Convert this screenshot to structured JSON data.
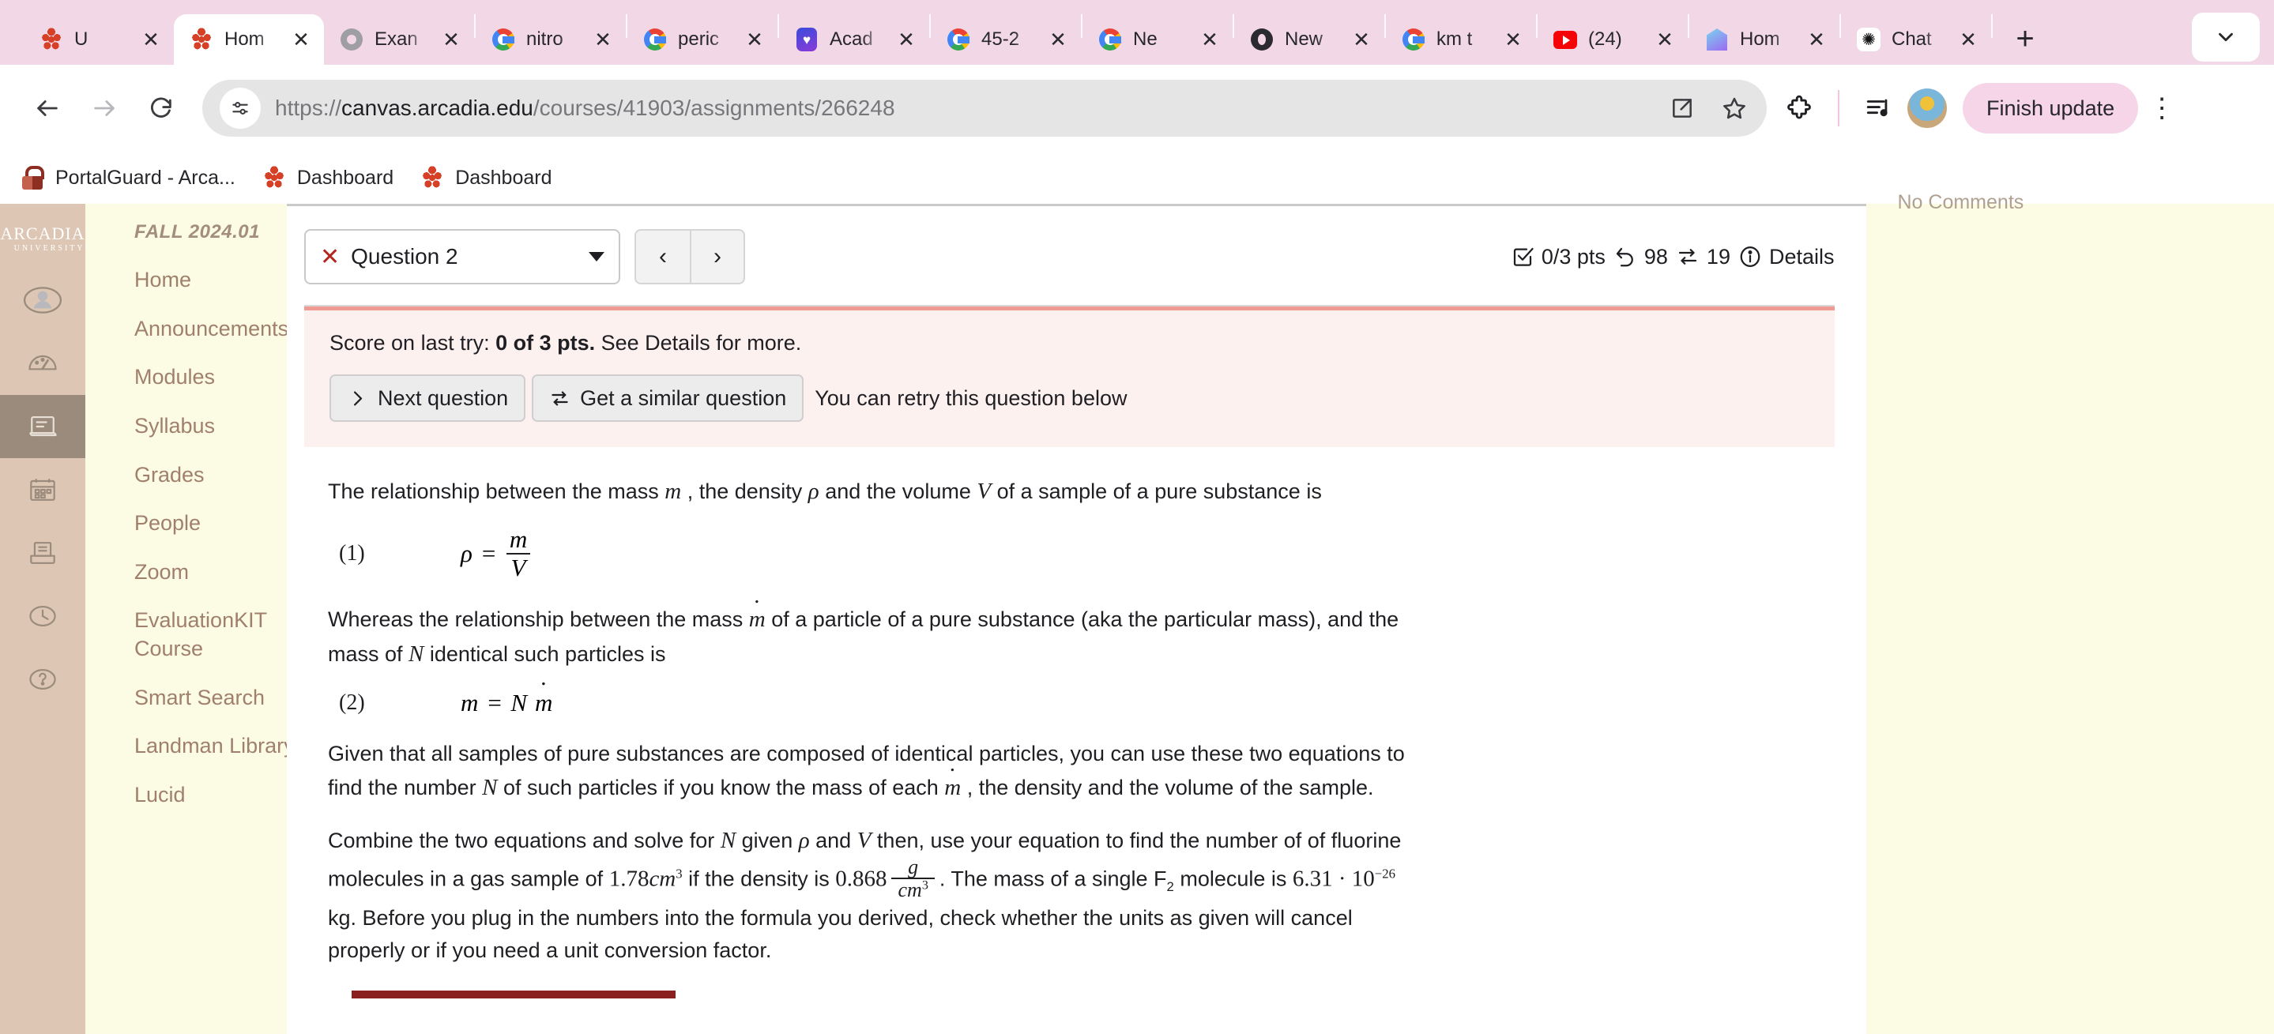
{
  "browser": {
    "tabs": [
      {
        "title": "U",
        "icon": "canvas-icon",
        "active": false,
        "favicon_extra": "😎"
      },
      {
        "title": "Hom",
        "icon": "canvas-icon",
        "active": true
      },
      {
        "title": "Exan",
        "icon": "grey-globe-icon",
        "active": false
      },
      {
        "title": "nitro",
        "icon": "google-icon",
        "active": false
      },
      {
        "title": "peric",
        "icon": "google-icon",
        "active": false
      },
      {
        "title": "Acad",
        "icon": "academia-heart-icon",
        "active": false
      },
      {
        "title": "45-2",
        "icon": "google-icon",
        "active": false
      },
      {
        "title": "Ne",
        "icon": "google-icon",
        "active": false
      },
      {
        "title": "New",
        "icon": "opera-icon",
        "active": false
      },
      {
        "title": "km t",
        "icon": "google-icon",
        "active": false
      },
      {
        "title": "(24)",
        "icon": "youtube-icon",
        "active": false
      },
      {
        "title": "Hom",
        "icon": "home-gem-icon",
        "active": false
      },
      {
        "title": "Chat",
        "icon": "chatgpt-icon",
        "active": false
      }
    ],
    "new_tab_label": "+",
    "url_full": "https://canvas.arcadia.edu/courses/41903/assignments/266248",
    "url_scheme": "https://",
    "url_host": "canvas.arcadia.edu",
    "url_path": "/courses/41903/assignments/266248",
    "finish_update_label": "Finish update",
    "bookmarks": [
      {
        "label": "PortalGuard - Arca...",
        "icon": "portalguard-lock-icon"
      },
      {
        "label": "Dashboard",
        "icon": "canvas-icon"
      },
      {
        "label": "Dashboard",
        "icon": "canvas-icon"
      }
    ]
  },
  "rail": {
    "logo_line1": "ARCADIA",
    "logo_line2": "UNIVERSITY",
    "items": [
      {
        "name": "account",
        "icon": "user-avatar-icon"
      },
      {
        "name": "dashboard",
        "icon": "gauge-icon"
      },
      {
        "name": "courses",
        "icon": "book-icon",
        "active": true
      },
      {
        "name": "calendar",
        "icon": "calendar-icon"
      },
      {
        "name": "inbox",
        "icon": "inbox-icon"
      },
      {
        "name": "history",
        "icon": "clock-icon"
      },
      {
        "name": "help",
        "icon": "question-icon"
      }
    ]
  },
  "course_nav": {
    "term": "FALL 2024.01",
    "items": [
      "Home",
      "Announcements",
      "Modules",
      "Syllabus",
      "Grades",
      "People",
      "Zoom",
      "EvaluationKIT Course",
      "Smart Search",
      "Landman Library",
      "Lucid"
    ]
  },
  "quiz": {
    "question_selector": {
      "label": "Question 2",
      "status_icon": "x-incorrect-icon"
    },
    "nav": {
      "prev": "‹",
      "next": "›"
    },
    "stats": {
      "points": "0/3 pts",
      "attempts": "98",
      "similar": "19",
      "details_label": "Details",
      "icons": [
        "checkbox-icon",
        "undo-arrow-icon",
        "swap-arrows-icon",
        "info-icon"
      ]
    },
    "alert": {
      "score_prefix": "Score on last try: ",
      "score_bold": "0 of 3 pts.",
      "score_suffix": " See Details for more.",
      "next_question_label": "Next question",
      "similar_question_label": "Get a similar question",
      "retry_note": "You can retry this question below"
    },
    "body": {
      "p1_a": "The relationship between the mass ",
      "p1_m": "m",
      "p1_b": " , the density ",
      "p1_rho": "ρ",
      "p1_c": " and the volume ",
      "p1_V": "V",
      "p1_d": " of a sample of a pure substance is",
      "eq1_number": "(1)",
      "eq1_lhs": "ρ",
      "eq1_eq": "=",
      "eq1_num": "m",
      "eq1_den": "V",
      "p2_a": "Whereas the relationship between the mass ",
      "p2_mdot": "m",
      "p2_b": " of a particle of a pure substance (aka the particular mass), and the mass of ",
      "p2_N": "N",
      "p2_c": " identical such particles is",
      "eq2_number": "(2)",
      "eq2_text": "m = N ṁ",
      "eq2_m": "m",
      "eq2_eq": "=",
      "eq2_N": "N",
      "eq2_mdot": "m",
      "p3_a": "Given that all samples of pure substances are composed of identical particles, you can use these two equations to find the number ",
      "p3_N": "N",
      "p3_b": " of such particles if you know the mass of each ",
      "p3_mdot": "m",
      "p3_c": " , the density and the volume of the sample.",
      "p4_a": " Combine the two equations and solve for ",
      "p4_N": "N",
      "p4_b": " given ",
      "p4_rho": "ρ",
      "p4_c": " and ",
      "p4_V": "V",
      "p4_d": " then,   use your equation to find the number of of fluorine molecules in a gas sample of ",
      "p4_vol": "1.78",
      "p4_vol_unit": "cm",
      "p4_vol_exp": "3",
      "p4_e": "  if the density is ",
      "p4_density": "0.868",
      "p4_density_num": "g",
      "p4_density_den": "cm",
      "p4_density_den_exp": "3",
      "p4_f": ". The mass of a single F",
      "p4_f_sub": "2",
      "p4_g": " molecule is ",
      "p4_mass": "6.31 · 10",
      "p4_mass_exp": "−26",
      "p4_h": " kg. Before you plug in the numbers into the formula you derived, check whether the units as given will cancel properly or if you need a unit conversion factor."
    }
  },
  "right_panel": {
    "no_comments": "No Comments"
  }
}
